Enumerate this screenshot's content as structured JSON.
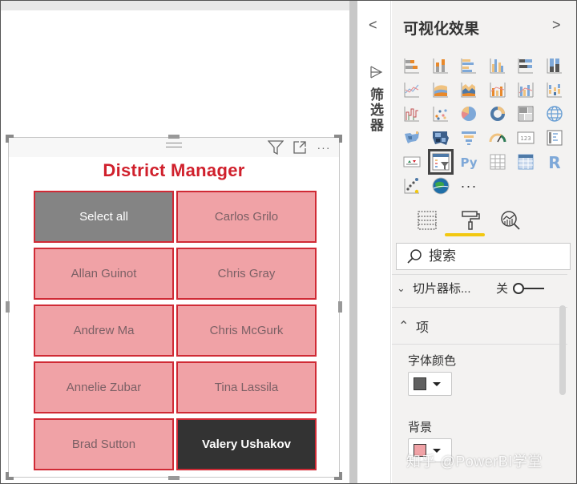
{
  "canvas": {
    "slicer": {
      "title": "District Manager",
      "title_color": "#d0202c",
      "header_icons": [
        "drag-grip-icon",
        "filter-icon",
        "focus-mode-icon",
        "more-options-icon"
      ],
      "more_label": "···",
      "tiles": [
        {
          "label": "Select all",
          "state": "select-all"
        },
        {
          "label": "Carlos Grilo",
          "state": "normal"
        },
        {
          "label": "Allan Guinot",
          "state": "normal"
        },
        {
          "label": "Chris Gray",
          "state": "normal"
        },
        {
          "label": "Andrew Ma",
          "state": "normal"
        },
        {
          "label": "Chris McGurk",
          "state": "normal"
        },
        {
          "label": "Annelie Zubar",
          "state": "normal"
        },
        {
          "label": "Tina Lassila",
          "state": "normal"
        },
        {
          "label": "Brad Sutton",
          "state": "normal"
        },
        {
          "label": "Valery Ushakov",
          "state": "selected"
        }
      ],
      "colors": {
        "tile_background": "#f0a2a6",
        "tile_border": "#d02a35",
        "tile_text": "#7b6065",
        "select_all_background": "#848484",
        "selected_background": "#333333"
      }
    }
  },
  "filters_pane": {
    "collapse_label": "<",
    "label": "筛选器"
  },
  "visualizations_pane": {
    "title": "可视化效果",
    "next_label": ">",
    "icons": [
      "stacked-bar-chart-icon",
      "stacked-column-chart-icon",
      "clustered-bar-chart-icon",
      "clustered-column-chart-icon",
      "100-stacked-bar-chart-icon",
      "100-stacked-column-chart-icon",
      "line-chart-icon",
      "area-chart-icon",
      "stacked-area-chart-icon",
      "line-and-stacked-column-chart-icon",
      "line-and-clustered-column-chart-icon",
      "ribbon-chart-icon",
      "waterfall-chart-icon",
      "scatter-chart-icon",
      "pie-chart-icon",
      "donut-chart-icon",
      "treemap-icon",
      "map-icon",
      "filled-map-icon",
      "shape-map-icon",
      "funnel-icon",
      "gauge-icon",
      "card-icon",
      "multi-row-card-icon",
      "kpi-icon",
      "slicer-icon",
      "python-visual-icon",
      "table-icon",
      "matrix-icon",
      "r-script-visual-icon",
      "key-influencers-icon",
      "arcgis-map-icon",
      "more-visuals-icon"
    ],
    "selected_icon": "slicer-icon",
    "more_visuals_label": "···",
    "tabs": [
      {
        "name": "fields-tab",
        "icon": "fields-icon"
      },
      {
        "name": "format-tab",
        "icon": "paint-roller-icon",
        "active": true
      },
      {
        "name": "analytics-tab",
        "icon": "analytics-icon"
      }
    ],
    "accent_color": "#f2c811",
    "search": {
      "placeholder": "搜索",
      "value": ""
    },
    "sections": {
      "slicer_header": {
        "label": "切片器标...",
        "toggle_label": "关",
        "toggle_on": false,
        "expanded": false
      },
      "items": {
        "label": "项",
        "expanded": true,
        "font_color_label": "字体颜色",
        "font_color": "#606060",
        "background_label": "背景",
        "background_color": "#f0a2a6"
      }
    }
  },
  "watermark": "知乎 @PowerBI学堂"
}
